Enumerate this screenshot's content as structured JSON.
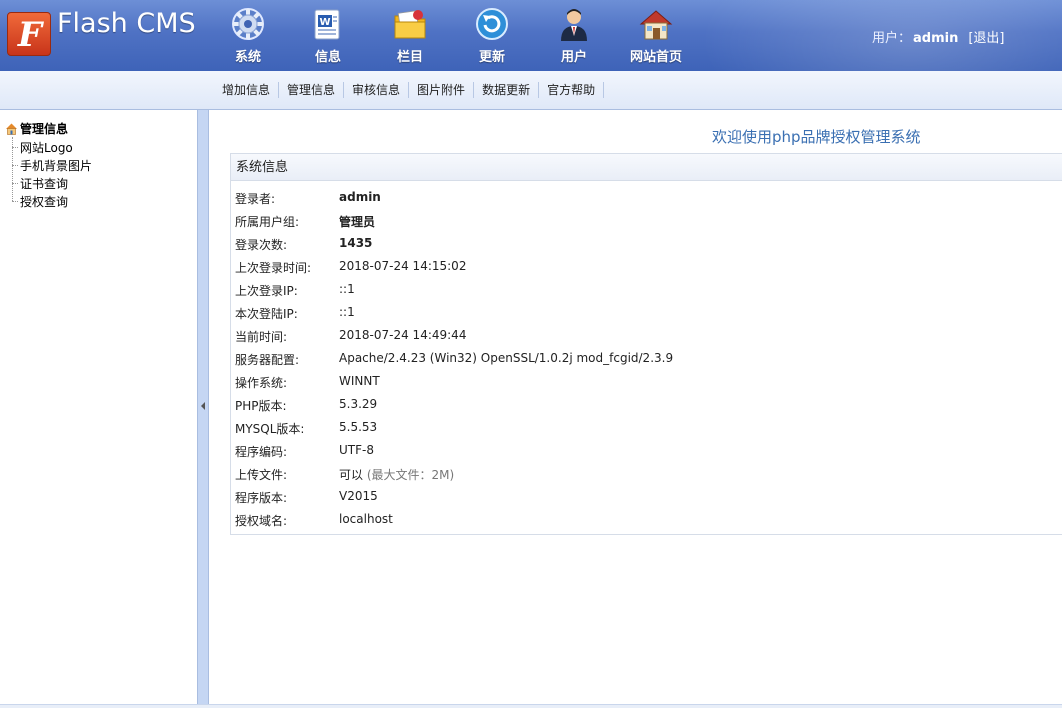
{
  "header": {
    "logo_glyph": "F",
    "logo_text": "Flash CMS",
    "nav": [
      {
        "label": "系统",
        "icon": "gear-icon"
      },
      {
        "label": "信息",
        "icon": "document-icon"
      },
      {
        "label": "栏目",
        "icon": "folder-icon"
      },
      {
        "label": "更新",
        "icon": "refresh-icon"
      },
      {
        "label": "用户",
        "icon": "user-icon"
      },
      {
        "label": "网站首页",
        "icon": "home-icon"
      }
    ],
    "user_label": "用户：",
    "username": "admin",
    "logout": "[退出]"
  },
  "submenu": [
    "增加信息",
    "管理信息",
    "审核信息",
    "图片附件",
    "数据更新",
    "官方帮助"
  ],
  "tree": {
    "root": "管理信息",
    "items": [
      "网站Logo",
      "手机背景图片",
      "证书查询",
      "授权查询"
    ]
  },
  "main": {
    "welcome": "欢迎使用php品牌授权管理系统",
    "panel_title": "系统信息",
    "rows": [
      {
        "key": "登录者:",
        "value": "admin",
        "bold": true
      },
      {
        "key": "所属用户组:",
        "value": "管理员",
        "bold": true
      },
      {
        "key": "登录次数:",
        "value": "1435",
        "bold": true
      },
      {
        "key": "上次登录时间:",
        "value": "2018-07-24 14:15:02"
      },
      {
        "key": "上次登录IP:",
        "value": "::1"
      },
      {
        "key": "本次登陆IP:",
        "value": "::1"
      },
      {
        "key": "当前时间:",
        "value": "2018-07-24 14:49:44"
      },
      {
        "key": "服务器配置:",
        "value": "Apache/2.4.23 (Win32) OpenSSL/1.0.2j mod_fcgid/2.3.9"
      },
      {
        "key": "操作系统:",
        "value": "WINNT"
      },
      {
        "key": "PHP版本:",
        "value": "5.3.29"
      },
      {
        "key": "MYSQL版本:",
        "value": "5.5.53"
      },
      {
        "key": "程序编码:",
        "value": "UTF-8"
      },
      {
        "key": "上传文件:",
        "value": "可以",
        "hint": "(最大文件：2M)"
      },
      {
        "key": "程序版本:",
        "value": "V2015"
      },
      {
        "key": "授权域名:",
        "value": "localhost"
      }
    ]
  },
  "colors": {
    "header_blue": "#4f72c4",
    "welcome_blue": "#3a6fb2",
    "splitter": "#c5d6f3"
  }
}
